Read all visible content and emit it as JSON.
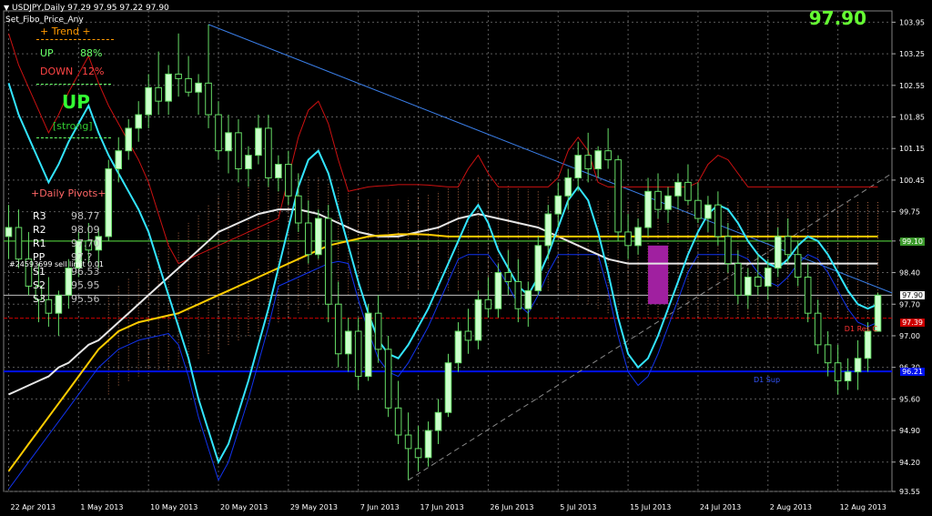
{
  "window": {
    "symbol_line": "USDJPY,Daily  97.29 97.95 97.22 97.90",
    "indicator_name": "Set_Fibo_Price_Any",
    "big_price": "97.90"
  },
  "trend_panel": {
    "title": "+  Trend  +",
    "up_label": "UP",
    "up_pct": "88%",
    "down_label": "DOWN",
    "down_pct": "12%",
    "signal": "UP",
    "strength": "[strong]"
  },
  "pivots": {
    "title": "+Daily Pivots+",
    "rows": [
      {
        "label": "R3",
        "value": "98.77"
      },
      {
        "label": "R2",
        "value": "98.09"
      },
      {
        "label": "R1",
        "value": "97.70"
      },
      {
        "label": "PP",
        "value": "97.?"
      },
      {
        "label": "S1",
        "value": "96.53"
      },
      {
        "label": "S2",
        "value": "95.95"
      },
      {
        "label": "S3",
        "value": "95.56"
      }
    ],
    "order_note": "#24593699 sell limit 0.01"
  },
  "colors": {
    "background": "#000000",
    "grid": "#5a5a5a",
    "bull_candle": "#ccffcc",
    "bear_candle": "#000000",
    "cyan_line": "#33e5ff",
    "red_line": "#cc1111",
    "blue_line": "#1133ee",
    "white_ma": "#e6e6e6",
    "yellow_ma": "#ffcc00",
    "ichimoku_cloud": "#ff9966",
    "trendline": "#3a7ee8",
    "green_level": "#3c9a2c",
    "red_level": "#cc0000",
    "blue_level": "#0011ee",
    "magenta_box": "#a020a0"
  },
  "levels": {
    "green_level_tag": "99.10",
    "current_tag": "97.90",
    "red_level_tag": "97.39",
    "red_level_label": "D1 Res C",
    "blue_level_tag": "96.21",
    "blue_level_label": "D1 Sup"
  },
  "chart_data": {
    "type": "candlestick",
    "title": "USDJPY,Daily",
    "ylim": [
      93.55,
      104.2
    ],
    "y_ticks": [
      "103.95",
      "103.25",
      "102.55",
      "101.85",
      "101.15",
      "100.45",
      "99.75",
      "99.10",
      "98.40",
      "97.70",
      "97.00",
      "96.30",
      "95.60",
      "94.90",
      "94.20",
      "93.55"
    ],
    "x_labels": [
      "22 Apr 2013",
      "1 May 2013",
      "10 May 2013",
      "20 May 2013",
      "29 May 2013",
      "7 Jun 2013",
      "17 Jun 2013",
      "26 Jun 2013",
      "5 Jul 2013",
      "15 Jul 2013",
      "24 Jul 2013",
      "2 Aug 2013",
      "12 Aug 2013"
    ],
    "candles": [
      {
        "o": 99.2,
        "h": 99.9,
        "l": 98.7,
        "c": 99.4
      },
      {
        "o": 99.4,
        "h": 99.8,
        "l": 98.5,
        "c": 98.7
      },
      {
        "o": 98.7,
        "h": 99.3,
        "l": 97.9,
        "c": 98.1
      },
      {
        "o": 98.1,
        "h": 98.6,
        "l": 97.3,
        "c": 97.8
      },
      {
        "o": 97.8,
        "h": 98.3,
        "l": 97.2,
        "c": 97.5
      },
      {
        "o": 97.5,
        "h": 98.0,
        "l": 97.0,
        "c": 97.9
      },
      {
        "o": 97.9,
        "h": 98.7,
        "l": 97.6,
        "c": 98.5
      },
      {
        "o": 98.5,
        "h": 99.3,
        "l": 98.3,
        "c": 99.1
      },
      {
        "o": 99.1,
        "h": 99.5,
        "l": 98.6,
        "c": 98.9
      },
      {
        "o": 98.9,
        "h": 99.4,
        "l": 98.5,
        "c": 99.2
      },
      {
        "o": 99.2,
        "h": 100.9,
        "l": 99.1,
        "c": 100.7
      },
      {
        "o": 100.7,
        "h": 101.4,
        "l": 100.4,
        "c": 101.1
      },
      {
        "o": 101.1,
        "h": 101.8,
        "l": 100.9,
        "c": 101.6
      },
      {
        "o": 101.6,
        "h": 102.2,
        "l": 101.3,
        "c": 101.9
      },
      {
        "o": 101.9,
        "h": 102.8,
        "l": 101.6,
        "c": 102.5
      },
      {
        "o": 102.5,
        "h": 103.3,
        "l": 101.9,
        "c": 102.2
      },
      {
        "o": 102.2,
        "h": 103.0,
        "l": 101.9,
        "c": 102.8
      },
      {
        "o": 102.8,
        "h": 103.7,
        "l": 102.3,
        "c": 102.7
      },
      {
        "o": 102.7,
        "h": 103.2,
        "l": 102.3,
        "c": 102.4
      },
      {
        "o": 102.4,
        "h": 102.8,
        "l": 101.9,
        "c": 102.6
      },
      {
        "o": 102.6,
        "h": 103.9,
        "l": 101.6,
        "c": 101.9
      },
      {
        "o": 101.9,
        "h": 102.2,
        "l": 100.9,
        "c": 101.1
      },
      {
        "o": 101.1,
        "h": 101.9,
        "l": 100.6,
        "c": 101.5
      },
      {
        "o": 101.5,
        "h": 101.8,
        "l": 100.4,
        "c": 100.7
      },
      {
        "o": 100.7,
        "h": 101.2,
        "l": 100.3,
        "c": 101.0
      },
      {
        "o": 101.0,
        "h": 101.9,
        "l": 100.8,
        "c": 101.6
      },
      {
        "o": 101.6,
        "h": 101.9,
        "l": 100.3,
        "c": 100.5
      },
      {
        "o": 100.5,
        "h": 101.0,
        "l": 100.2,
        "c": 100.8
      },
      {
        "o": 100.8,
        "h": 101.1,
        "l": 99.9,
        "c": 100.1
      },
      {
        "o": 100.1,
        "h": 100.6,
        "l": 99.3,
        "c": 99.5
      },
      {
        "o": 99.5,
        "h": 100.0,
        "l": 98.6,
        "c": 98.8
      },
      {
        "o": 98.8,
        "h": 99.8,
        "l": 98.7,
        "c": 99.6
      },
      {
        "o": 99.6,
        "h": 99.9,
        "l": 97.3,
        "c": 97.7
      },
      {
        "o": 97.7,
        "h": 98.2,
        "l": 96.3,
        "c": 96.6
      },
      {
        "o": 96.6,
        "h": 97.4,
        "l": 96.2,
        "c": 97.1
      },
      {
        "o": 97.1,
        "h": 97.4,
        "l": 95.8,
        "c": 96.1
      },
      {
        "o": 96.1,
        "h": 97.7,
        "l": 96.0,
        "c": 97.5
      },
      {
        "o": 97.5,
        "h": 97.9,
        "l": 96.4,
        "c": 96.7
      },
      {
        "o": 96.7,
        "h": 97.0,
        "l": 95.2,
        "c": 95.4
      },
      {
        "o": 95.4,
        "h": 96.0,
        "l": 94.6,
        "c": 94.8
      },
      {
        "o": 94.8,
        "h": 95.3,
        "l": 93.8,
        "c": 94.5
      },
      {
        "o": 94.5,
        "h": 95.0,
        "l": 94.0,
        "c": 94.3
      },
      {
        "o": 94.3,
        "h": 95.1,
        "l": 94.1,
        "c": 94.9
      },
      {
        "o": 94.9,
        "h": 95.6,
        "l": 94.6,
        "c": 95.3
      },
      {
        "o": 95.3,
        "h": 96.6,
        "l": 95.2,
        "c": 96.4
      },
      {
        "o": 96.4,
        "h": 97.3,
        "l": 96.2,
        "c": 97.1
      },
      {
        "o": 97.1,
        "h": 97.6,
        "l": 96.6,
        "c": 96.9
      },
      {
        "o": 96.9,
        "h": 98.0,
        "l": 96.7,
        "c": 97.8
      },
      {
        "o": 97.8,
        "h": 98.3,
        "l": 97.4,
        "c": 97.6
      },
      {
        "o": 97.6,
        "h": 98.6,
        "l": 97.4,
        "c": 98.4
      },
      {
        "o": 98.4,
        "h": 98.9,
        "l": 97.9,
        "c": 98.2
      },
      {
        "o": 98.2,
        "h": 98.7,
        "l": 97.3,
        "c": 97.6
      },
      {
        "o": 97.6,
        "h": 98.2,
        "l": 97.2,
        "c": 98.0
      },
      {
        "o": 98.0,
        "h": 99.2,
        "l": 97.9,
        "c": 99.0
      },
      {
        "o": 99.0,
        "h": 99.9,
        "l": 98.7,
        "c": 99.7
      },
      {
        "o": 99.7,
        "h": 100.4,
        "l": 99.4,
        "c": 100.1
      },
      {
        "o": 100.1,
        "h": 100.7,
        "l": 99.8,
        "c": 100.5
      },
      {
        "o": 100.5,
        "h": 101.3,
        "l": 100.2,
        "c": 101.0
      },
      {
        "o": 101.0,
        "h": 101.5,
        "l": 100.4,
        "c": 100.7
      },
      {
        "o": 100.7,
        "h": 101.2,
        "l": 100.5,
        "c": 101.1
      },
      {
        "o": 101.1,
        "h": 101.6,
        "l": 100.7,
        "c": 100.9
      },
      {
        "o": 100.9,
        "h": 101.0,
        "l": 99.1,
        "c": 99.3
      },
      {
        "o": 99.3,
        "h": 99.7,
        "l": 98.7,
        "c": 99.0
      },
      {
        "o": 99.0,
        "h": 99.6,
        "l": 98.8,
        "c": 99.4
      },
      {
        "o": 99.4,
        "h": 100.5,
        "l": 99.2,
        "c": 100.2
      },
      {
        "o": 100.2,
        "h": 100.6,
        "l": 99.6,
        "c": 99.8
      },
      {
        "o": 99.8,
        "h": 100.3,
        "l": 99.5,
        "c": 100.1
      },
      {
        "o": 100.1,
        "h": 100.6,
        "l": 99.8,
        "c": 100.4
      },
      {
        "o": 100.4,
        "h": 100.8,
        "l": 99.9,
        "c": 100.0
      },
      {
        "o": 100.0,
        "h": 100.4,
        "l": 99.5,
        "c": 99.6
      },
      {
        "o": 99.6,
        "h": 100.1,
        "l": 99.3,
        "c": 99.9
      },
      {
        "o": 99.9,
        "h": 100.2,
        "l": 99.0,
        "c": 99.2
      },
      {
        "o": 99.2,
        "h": 99.5,
        "l": 98.4,
        "c": 98.6
      },
      {
        "o": 98.6,
        "h": 98.9,
        "l": 97.7,
        "c": 97.9
      },
      {
        "o": 97.9,
        "h": 98.5,
        "l": 97.6,
        "c": 98.3
      },
      {
        "o": 98.3,
        "h": 98.8,
        "l": 97.9,
        "c": 98.1
      },
      {
        "o": 98.1,
        "h": 98.7,
        "l": 97.8,
        "c": 98.5
      },
      {
        "o": 98.5,
        "h": 99.4,
        "l": 98.3,
        "c": 99.2
      },
      {
        "o": 99.2,
        "h": 99.6,
        "l": 98.6,
        "c": 98.8
      },
      {
        "o": 98.8,
        "h": 99.1,
        "l": 98.1,
        "c": 98.3
      },
      {
        "o": 98.3,
        "h": 98.6,
        "l": 97.3,
        "c": 97.5
      },
      {
        "o": 97.5,
        "h": 97.8,
        "l": 96.6,
        "c": 96.8
      },
      {
        "o": 96.8,
        "h": 97.1,
        "l": 96.1,
        "c": 96.4
      },
      {
        "o": 96.4,
        "h": 96.8,
        "l": 95.7,
        "c": 96.0
      },
      {
        "o": 96.0,
        "h": 96.5,
        "l": 95.8,
        "c": 96.2
      },
      {
        "o": 96.2,
        "h": 96.9,
        "l": 95.8,
        "c": 96.5
      },
      {
        "o": 96.5,
        "h": 97.3,
        "l": 96.2,
        "c": 97.1
      },
      {
        "o": 97.1,
        "h": 97.95,
        "l": 97.22,
        "c": 97.9
      }
    ],
    "lines": {
      "cyan": [
        102.6,
        101.9,
        101.4,
        100.9,
        100.4,
        100.8,
        101.3,
        101.7,
        102.1,
        101.5,
        101.0,
        100.6,
        100.2,
        99.8,
        99.3,
        98.6,
        97.9,
        97.2,
        96.5,
        95.6,
        94.9,
        94.2,
        94.6,
        95.3,
        96.0,
        96.8,
        97.6,
        98.5,
        99.4,
        100.3,
        100.9,
        101.1,
        100.6,
        99.8,
        99.0,
        98.2,
        97.5,
        96.9,
        96.6,
        96.5,
        96.8,
        97.2,
        97.6,
        98.1,
        98.6,
        99.1,
        99.6,
        99.9,
        99.5,
        98.9,
        98.5,
        98.1,
        97.9,
        98.3,
        98.8,
        99.4,
        100.0,
        100.3,
        100.0,
        99.3,
        98.4,
        97.4,
        96.6,
        96.3,
        96.5,
        97.0,
        97.6,
        98.2,
        98.8,
        99.3,
        99.7,
        99.9,
        99.8,
        99.5,
        99.1,
        98.8,
        98.6,
        98.5,
        98.7,
        99.0,
        99.2,
        99.1,
        98.8,
        98.4,
        98.0,
        97.7,
        97.6,
        97.7
      ],
      "white_ma": [
        95.7,
        95.8,
        95.9,
        96.0,
        96.1,
        96.3,
        96.4,
        96.6,
        96.8,
        96.9,
        97.1,
        97.3,
        97.5,
        97.7,
        97.9,
        98.1,
        98.3,
        98.5,
        98.7,
        98.9,
        99.1,
        99.3,
        99.4,
        99.5,
        99.6,
        99.7,
        99.75,
        99.8,
        99.8,
        99.8,
        99.75,
        99.7,
        99.6,
        99.5,
        99.4,
        99.3,
        99.25,
        99.2,
        99.2,
        99.2,
        99.25,
        99.3,
        99.35,
        99.4,
        99.5,
        99.6,
        99.65,
        99.7,
        99.65,
        99.6,
        99.55,
        99.5,
        99.45,
        99.4,
        99.3,
        99.2,
        99.1,
        99.0,
        98.9,
        98.8,
        98.7,
        98.65,
        98.6,
        98.6,
        98.6,
        98.6,
        98.6,
        98.6,
        98.6,
        98.6,
        98.6,
        98.6,
        98.6,
        98.6,
        98.6,
        98.6,
        98.6,
        98.6,
        98.6,
        98.6,
        98.6,
        98.6,
        98.6,
        98.6,
        98.6,
        98.6,
        98.6,
        98.6
      ],
      "yellow_ma": [
        94.0,
        94.3,
        94.6,
        94.9,
        95.2,
        95.5,
        95.8,
        96.1,
        96.4,
        96.7,
        96.9,
        97.1,
        97.2,
        97.3,
        97.35,
        97.4,
        97.45,
        97.5,
        97.6,
        97.7,
        97.8,
        97.9,
        98.0,
        98.1,
        98.2,
        98.3,
        98.4,
        98.5,
        98.6,
        98.7,
        98.8,
        98.9,
        99.0,
        99.05,
        99.1,
        99.15,
        99.2,
        99.22,
        99.23,
        99.25,
        99.25,
        99.25,
        99.24,
        99.22,
        99.2,
        99.2,
        99.2,
        99.2,
        99.2,
        99.2,
        99.2,
        99.2,
        99.2,
        99.2,
        99.2,
        99.2,
        99.2,
        99.2,
        99.2,
        99.2,
        99.2,
        99.2,
        99.2,
        99.2,
        99.2,
        99.2,
        99.2,
        99.2,
        99.2,
        99.2,
        99.2,
        99.2,
        99.2,
        99.2,
        99.2,
        99.2,
        99.2,
        99.2,
        99.2,
        99.2,
        99.2,
        99.2,
        99.2,
        99.2,
        99.2,
        99.2,
        99.2,
        99.2
      ]
    },
    "magenta_box": {
      "x_from": 64,
      "x_to": 66,
      "y_from": 97.7,
      "y_to": 99.0
    }
  }
}
